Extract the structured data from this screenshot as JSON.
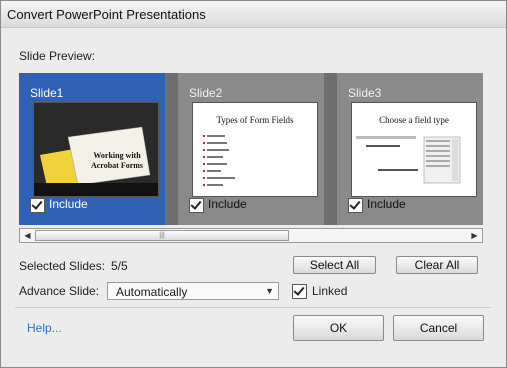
{
  "window": {
    "title": "Convert PowerPoint Presentations"
  },
  "preview": {
    "label": "Slide Preview:",
    "slides": [
      {
        "name": "Slide1",
        "include": "Include",
        "heading": "Working with Acrobat Forms",
        "selected": true
      },
      {
        "name": "Slide2",
        "include": "Include",
        "heading": "Types of Form Fields",
        "selected": false
      },
      {
        "name": "Slide3",
        "include": "Include",
        "heading": "Choose a field type",
        "selected": false
      }
    ],
    "scroll_grip": "|||"
  },
  "selection": {
    "label": "Selected Slides:",
    "value": "5/5",
    "select_all": "Select All",
    "clear_all": "Clear All"
  },
  "advance": {
    "label": "Advance Slide:",
    "value": "Automatically",
    "linked": "Linked"
  },
  "footer": {
    "help": "Help...",
    "ok": "OK",
    "cancel": "Cancel"
  },
  "colors": {
    "selected_thumb": "#2f62b5",
    "strip": "#6e6e6e",
    "link": "#2d6fd0"
  }
}
